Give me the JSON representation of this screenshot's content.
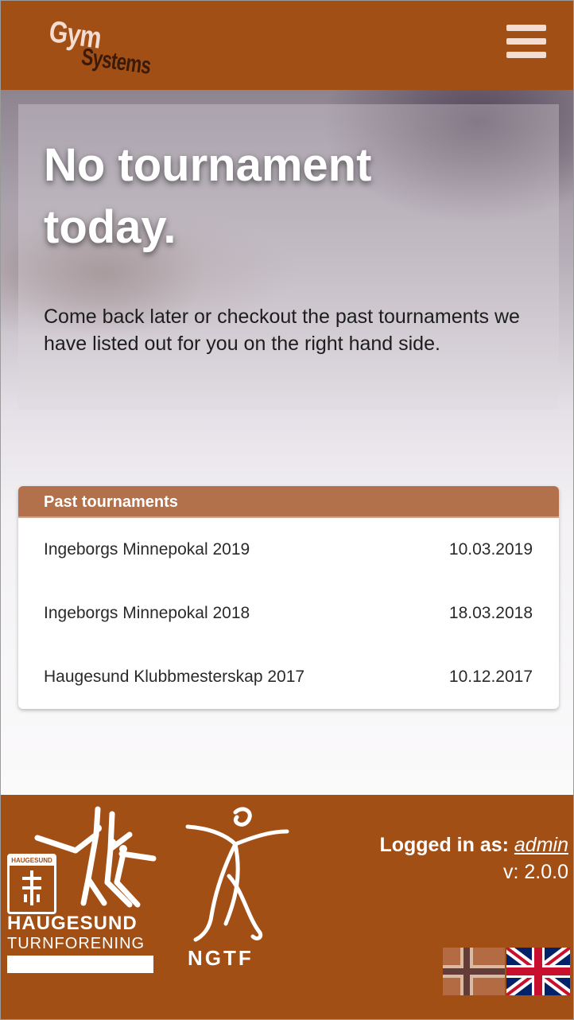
{
  "header": {
    "logo_line1": "Gym",
    "logo_line2": "Systems",
    "menu_icon": "hamburger-menu-icon"
  },
  "hero": {
    "title": "No tournament today.",
    "text": "Come back later or checkout the past tournaments we have listed out for you on the right hand side."
  },
  "past_tournaments": {
    "heading": "Past tournaments",
    "items": [
      {
        "name": "Ingeborgs Minnepokal 2019",
        "date": "10.03.2019"
      },
      {
        "name": "Ingeborgs Minnepokal 2018",
        "date": "18.03.2018"
      },
      {
        "name": "Haugesund Klubbmesterskap 2017",
        "date": "10.12.2017"
      }
    ]
  },
  "footer": {
    "club_badge_text": "HAUGESUND",
    "club_name_line1": "HAUGESUND",
    "club_name_line2": "TURNFORENING",
    "federation": "NGTF",
    "logged_in_label": "Logged in as:",
    "username": "admin",
    "version": "v: 2.0.0",
    "languages": [
      "norwegian-flag-icon",
      "uk-flag-icon"
    ]
  },
  "colors": {
    "brand": "#a24f16",
    "card_header": "#b2714a",
    "logo_light": "#f3ddd2"
  }
}
